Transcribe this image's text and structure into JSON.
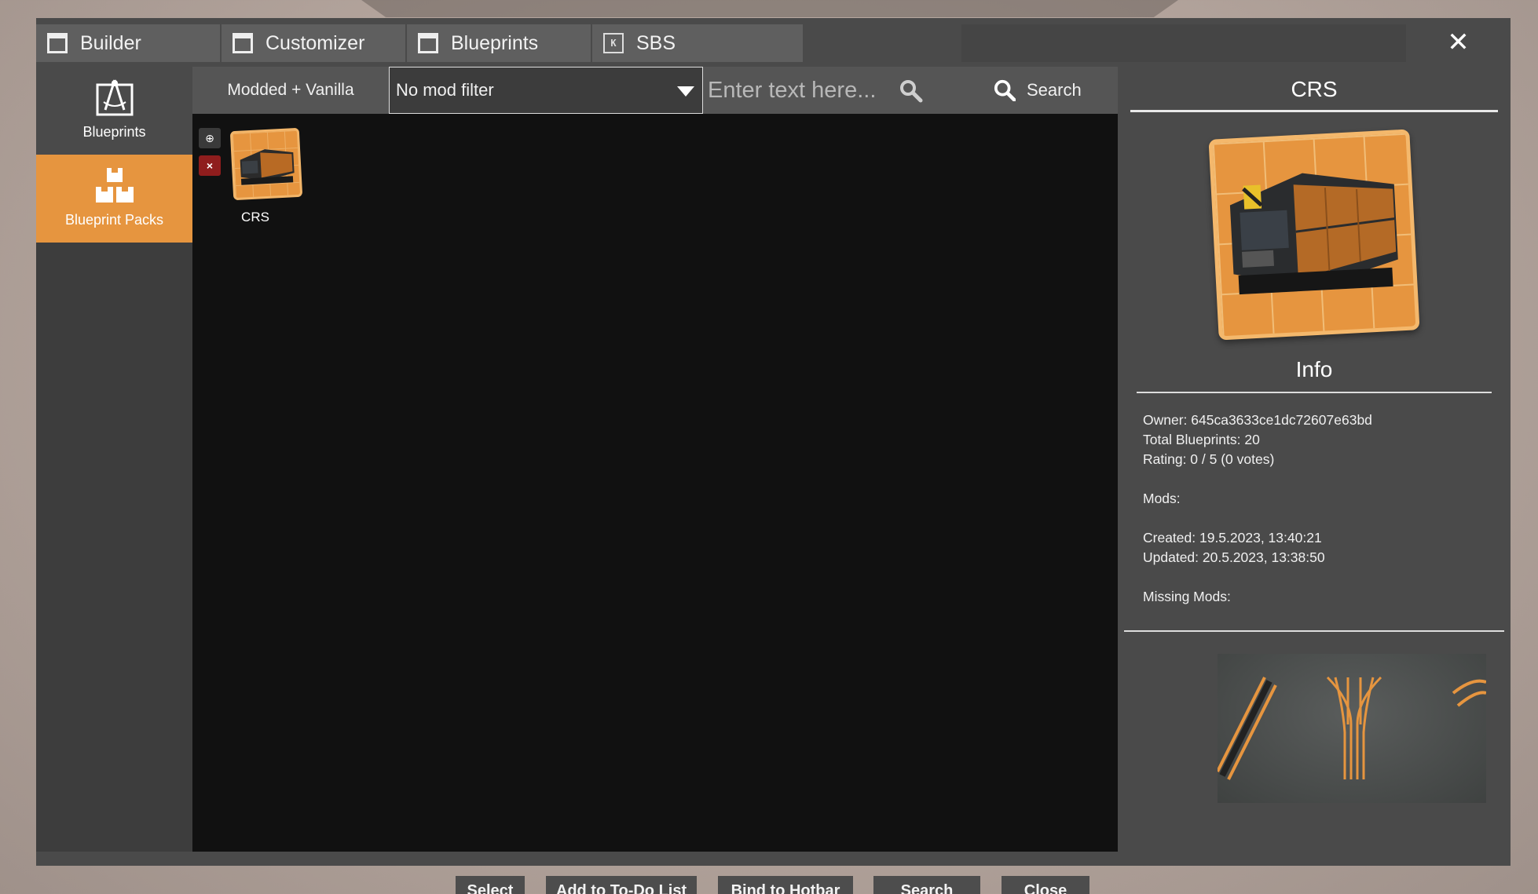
{
  "tabs": [
    {
      "label": "Builder",
      "icon": "window-icon"
    },
    {
      "label": "Customizer",
      "icon": "window-icon"
    },
    {
      "label": "Blueprints",
      "icon": "window-icon"
    },
    {
      "label": "SBS",
      "icon": "sbs-icon",
      "icon_text": "K"
    }
  ],
  "close_symbol": "✕",
  "sidebar": {
    "items": [
      {
        "label": "Blueprints",
        "icon": "blueprint-compass-icon"
      },
      {
        "label": "Blueprint Packs",
        "icon": "blocks-icon",
        "active": true
      }
    ]
  },
  "toolbar": {
    "filter_mode": "Modded + Vanilla",
    "mod_filter_selected": "No mod filter",
    "search_placeholder": "Enter text here...",
    "search_label": "Search"
  },
  "grid": {
    "items": [
      {
        "label": "CRS"
      }
    ],
    "globe_symbol": "⊕",
    "delete_symbol": "×"
  },
  "details": {
    "title": "CRS",
    "info_heading": "Info",
    "owner": "Owner: 645ca3633ce1dc72607e63bd",
    "total": "Total Blueprints: 20",
    "rating": "Rating: 0 / 5 (0 votes)",
    "mods": "Mods:",
    "created": "Created: 19.5.2023, 13:40:21",
    "updated": "Updated: 20.5.2023, 13:38:50",
    "missing": "Missing Mods:"
  },
  "footer": {
    "buttons": [
      "Select",
      "Add to To-Do List",
      "Bind to Hotbar",
      "Search",
      "Close"
    ]
  },
  "colors": {
    "accent": "#e6953f",
    "panel": "#4a4a4a",
    "grid_bg": "#111111",
    "delete_red": "#8f1d1d"
  }
}
